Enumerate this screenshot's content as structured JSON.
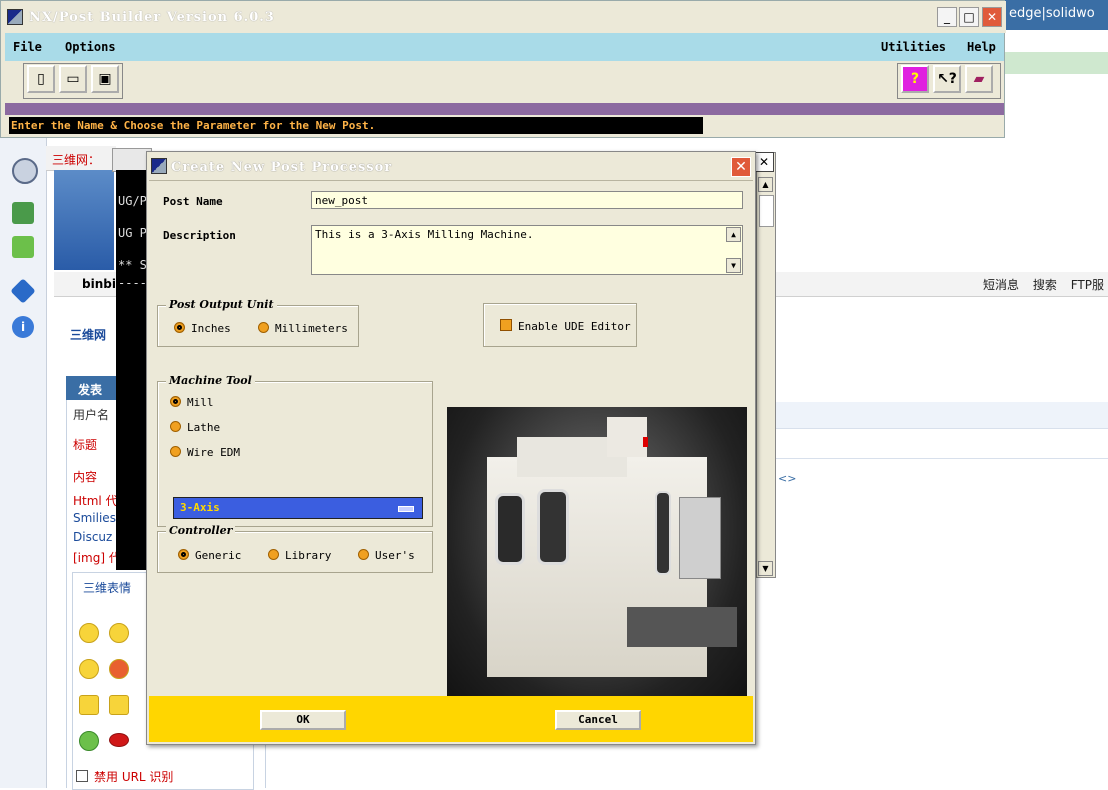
{
  "background_browser": {
    "topbar_text": "edge|solidwo",
    "address_prefix": "三维网：",
    "user_name": "binbi",
    "breadcrumb": "三维网",
    "nav_right": [
      "短消息",
      "搜索",
      "FTP服"
    ],
    "form_header": "发表",
    "form_rows": [
      "用户名",
      "标题",
      "内容",
      "Html 代",
      "Smilies",
      "Discuz",
      "[img] 代"
    ],
    "smilies_tab": "三维表情",
    "disable_url": "禁用 URL 识别",
    "arrow_text": "<>"
  },
  "console": {
    "lines": [
      "UG/P",
      "UG P",
      "** S",
      "----"
    ]
  },
  "nx_window": {
    "title": "NX/Post Builder Version 6.0.3",
    "menu": {
      "file": "File",
      "options": "Options",
      "utilities": "Utilities",
      "help": "Help"
    },
    "status": "Enter the Name & Choose the Parameter for the New Post."
  },
  "dialog": {
    "title": "Create New Post Processor",
    "post_name_label": "Post Name",
    "post_name_value": "new_post",
    "description_label": "Description",
    "description_value": "This is a 3-Axis Milling Machine.",
    "output_unit": {
      "title": "Post Output Unit",
      "options": [
        "Inches",
        "Millimeters"
      ],
      "selected": "Inches"
    },
    "ude_editor_label": "Enable UDE Editor",
    "machine_tool": {
      "title": "Machine Tool",
      "options": [
        "Mill",
        "Lathe",
        "Wire EDM"
      ],
      "selected": "Mill",
      "axis_value": "3-Axis"
    },
    "controller": {
      "title": "Controller",
      "options": [
        "Generic",
        "Library",
        "User's"
      ],
      "selected": "Generic"
    },
    "ok_label": "OK",
    "cancel_label": "Cancel"
  },
  "colors": {
    "menubar": "#a9dbe8",
    "footer": "#ffd600",
    "status_text": "#ffb347",
    "axis_select": "#3b5ee0"
  }
}
